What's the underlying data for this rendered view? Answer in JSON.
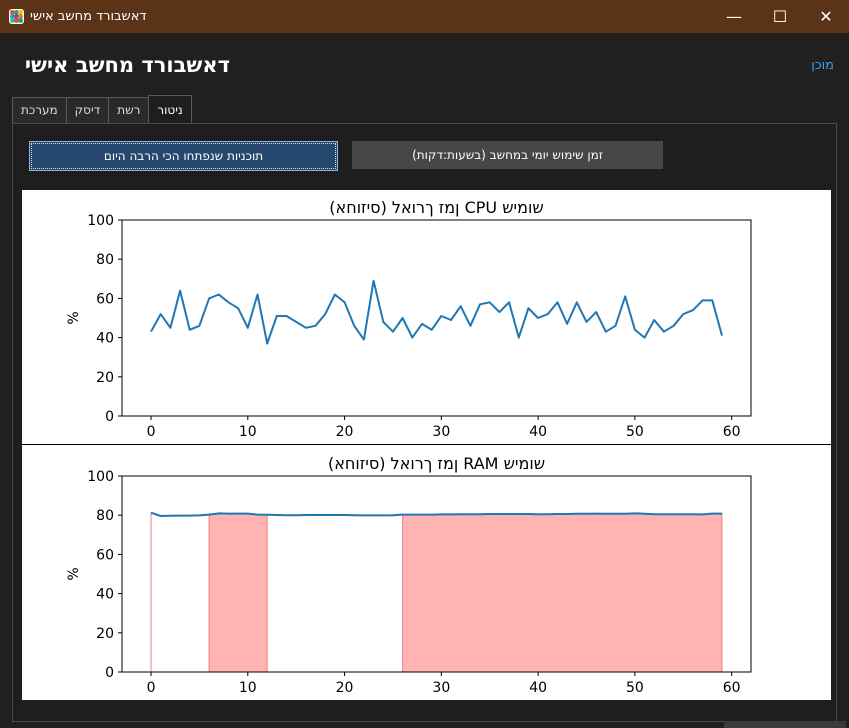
{
  "window": {
    "title": "דאשבורד מחשב אישי",
    "minimize_glyph": "—",
    "maximize_glyph": "☐",
    "close_glyph": "✕"
  },
  "header": {
    "title": "דאשבורד מחשב אישי",
    "status": "מוכן",
    "status_color": "#3aa0f0"
  },
  "tabs": [
    {
      "label": "מערכת",
      "active": false
    },
    {
      "label": "דיסק",
      "active": false
    },
    {
      "label": "רשת",
      "active": false
    },
    {
      "label": "ניטור",
      "active": true
    }
  ],
  "buttons": {
    "daily_usage": "זמן שימוש יומי במחשב (בשעות:דקות)",
    "top_programs": "תוכניות שנפתחו הכי הרבה היום"
  },
  "chart_data": [
    {
      "type": "line",
      "title": "(סיזוחא) ןמז ךרואל CPU שומיש",
      "ylabel": "%",
      "xlabel": "",
      "xlim": [
        -3,
        62
      ],
      "ylim": [
        0,
        100
      ],
      "xticks": [
        0,
        10,
        20,
        30,
        40,
        50,
        60
      ],
      "yticks": [
        0,
        20,
        40,
        60,
        80,
        100
      ],
      "color": "#1f77b4",
      "x": [
        0,
        1,
        2,
        3,
        4,
        5,
        6,
        7,
        8,
        9,
        10,
        11,
        12,
        13,
        14,
        15,
        16,
        17,
        18,
        19,
        20,
        21,
        22,
        23,
        24,
        25,
        26,
        27,
        28,
        29,
        30,
        31,
        32,
        33,
        34,
        35,
        36,
        37,
        38,
        39,
        40,
        41,
        42,
        43,
        44,
        45,
        46,
        47,
        48,
        49,
        50,
        51,
        52,
        53,
        54,
        55,
        56,
        57,
        58,
        59
      ],
      "y": [
        43,
        52,
        45,
        64,
        44,
        46,
        60,
        62,
        58,
        55,
        45,
        62,
        37,
        51,
        51,
        48,
        45,
        46,
        52,
        62,
        58,
        46,
        39,
        69,
        48,
        43,
        50,
        40,
        47,
        44,
        51,
        49,
        56,
        46,
        57,
        58,
        53,
        58,
        40,
        55,
        50,
        52,
        58,
        47,
        58,
        48,
        53,
        43,
        46,
        61,
        44,
        40,
        49,
        43,
        46,
        52,
        54,
        59,
        59,
        41
      ],
      "grid": false,
      "legend": "none"
    },
    {
      "type": "area",
      "title": "(סיזוחא) ןמז ךרואל RAM שומיש",
      "ylabel": "%",
      "xlabel": "",
      "xlim": [
        -3,
        62
      ],
      "ylim": [
        0,
        100
      ],
      "xticks": [
        0,
        10,
        20,
        30,
        40,
        50,
        60
      ],
      "yticks": [
        0,
        20,
        40,
        60,
        80,
        100
      ],
      "color": "#1f77b4",
      "fill_color": "#ffb3b3",
      "fill_regions": [
        [
          0,
          0
        ],
        [
          6,
          12
        ],
        [
          26,
          59
        ]
      ],
      "x": [
        0,
        1,
        2,
        3,
        4,
        5,
        6,
        7,
        8,
        9,
        10,
        11,
        12,
        13,
        14,
        15,
        16,
        17,
        18,
        19,
        20,
        21,
        22,
        23,
        24,
        25,
        26,
        27,
        28,
        29,
        30,
        31,
        32,
        33,
        34,
        35,
        36,
        37,
        38,
        39,
        40,
        41,
        42,
        43,
        44,
        45,
        46,
        47,
        48,
        49,
        50,
        51,
        52,
        53,
        54,
        55,
        56,
        57,
        58,
        59
      ],
      "y": [
        81.3,
        79.6,
        79.7,
        79.8,
        79.8,
        79.9,
        80.3,
        80.9,
        80.8,
        80.8,
        80.8,
        80.3,
        80.2,
        80.1,
        80.0,
        80.0,
        80.1,
        80.1,
        80.1,
        80.1,
        80.1,
        80.0,
        79.9,
        79.9,
        79.9,
        80.0,
        80.3,
        80.3,
        80.3,
        80.3,
        80.4,
        80.4,
        80.5,
        80.5,
        80.5,
        80.6,
        80.6,
        80.6,
        80.6,
        80.6,
        80.5,
        80.5,
        80.6,
        80.6,
        80.7,
        80.7,
        80.8,
        80.7,
        80.7,
        80.7,
        80.9,
        80.7,
        80.5,
        80.5,
        80.5,
        80.5,
        80.5,
        80.4,
        80.8,
        80.8
      ],
      "grid": false,
      "legend": "none"
    }
  ]
}
